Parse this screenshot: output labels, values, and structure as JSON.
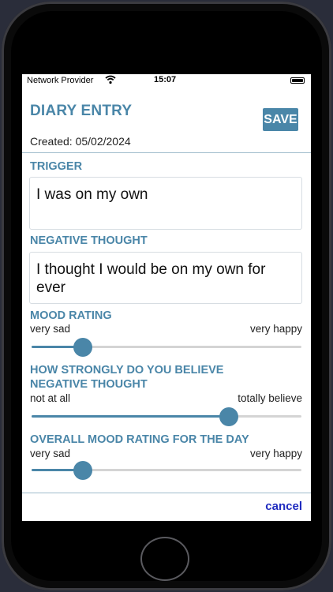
{
  "status_bar": {
    "carrier": "Network Provider",
    "time": "15:07"
  },
  "header": {
    "title": "DIARY ENTRY",
    "save_label": "SAVE",
    "created": "Created: 05/02/2024"
  },
  "trigger": {
    "label": "TRIGGER",
    "value": "I was on my own"
  },
  "negative_thought": {
    "label": "NEGATIVE THOUGHT",
    "value": "I thought I would be on my own for ever"
  },
  "mood_rating": {
    "label": "MOOD RATING",
    "min_label": "very sad",
    "max_label": "very happy",
    "value": 0.19
  },
  "belief": {
    "label": "HOW STRONGLY DO YOU BELIEVE NEGATIVE THOUGHT",
    "min_label": "not at all",
    "max_label": "totally believe",
    "value": 0.73
  },
  "overall_mood": {
    "label": "OVERALL MOOD RATING FOR THE DAY",
    "min_label": "very sad",
    "max_label": "very happy",
    "value": 0.19
  },
  "footer": {
    "cancel_label": "cancel"
  },
  "colors": {
    "accent": "#4a86a8",
    "link": "#1f2bbf"
  }
}
